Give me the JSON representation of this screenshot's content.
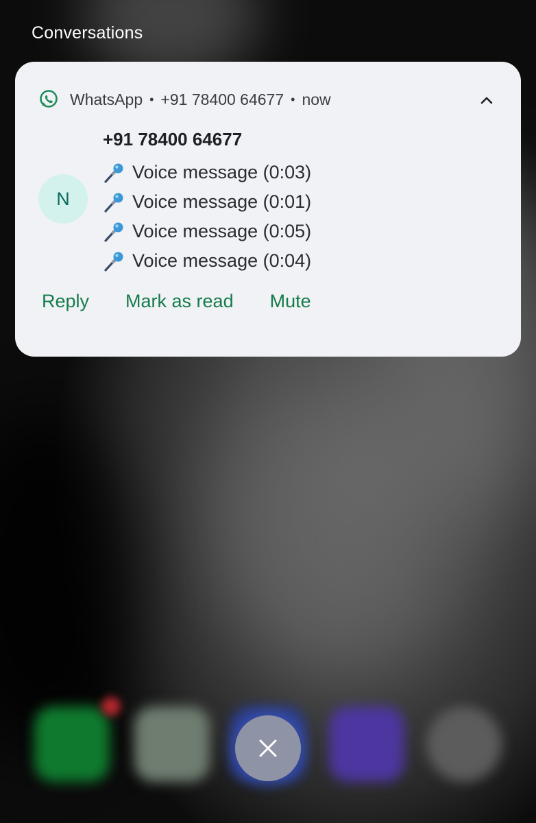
{
  "section_title": "Conversations",
  "notification": {
    "app_name": "WhatsApp",
    "separator": "•",
    "header_sender": "+91 78400 64677",
    "time": "now",
    "avatar_initial": "N",
    "title": "+91 78400 64677",
    "messages": [
      "Voice message (0:03)",
      "Voice message (0:01)",
      "Voice message (0:05)",
      "Voice message (0:04)"
    ],
    "actions": {
      "reply": "Reply",
      "mark_as_read": "Mark as read",
      "mute": "Mute"
    }
  },
  "icons": {
    "app": "whatsapp-icon",
    "collapse": "chevron-up-icon",
    "message": "microphone-icon",
    "close_all": "close-icon"
  },
  "colors": {
    "accent": "#157c4a",
    "whatsapp": "#1f8c5b",
    "card_bg": "#f1f2f5",
    "avatar_bg": "#d3f2ee",
    "avatar_text": "#0d6b5e"
  }
}
